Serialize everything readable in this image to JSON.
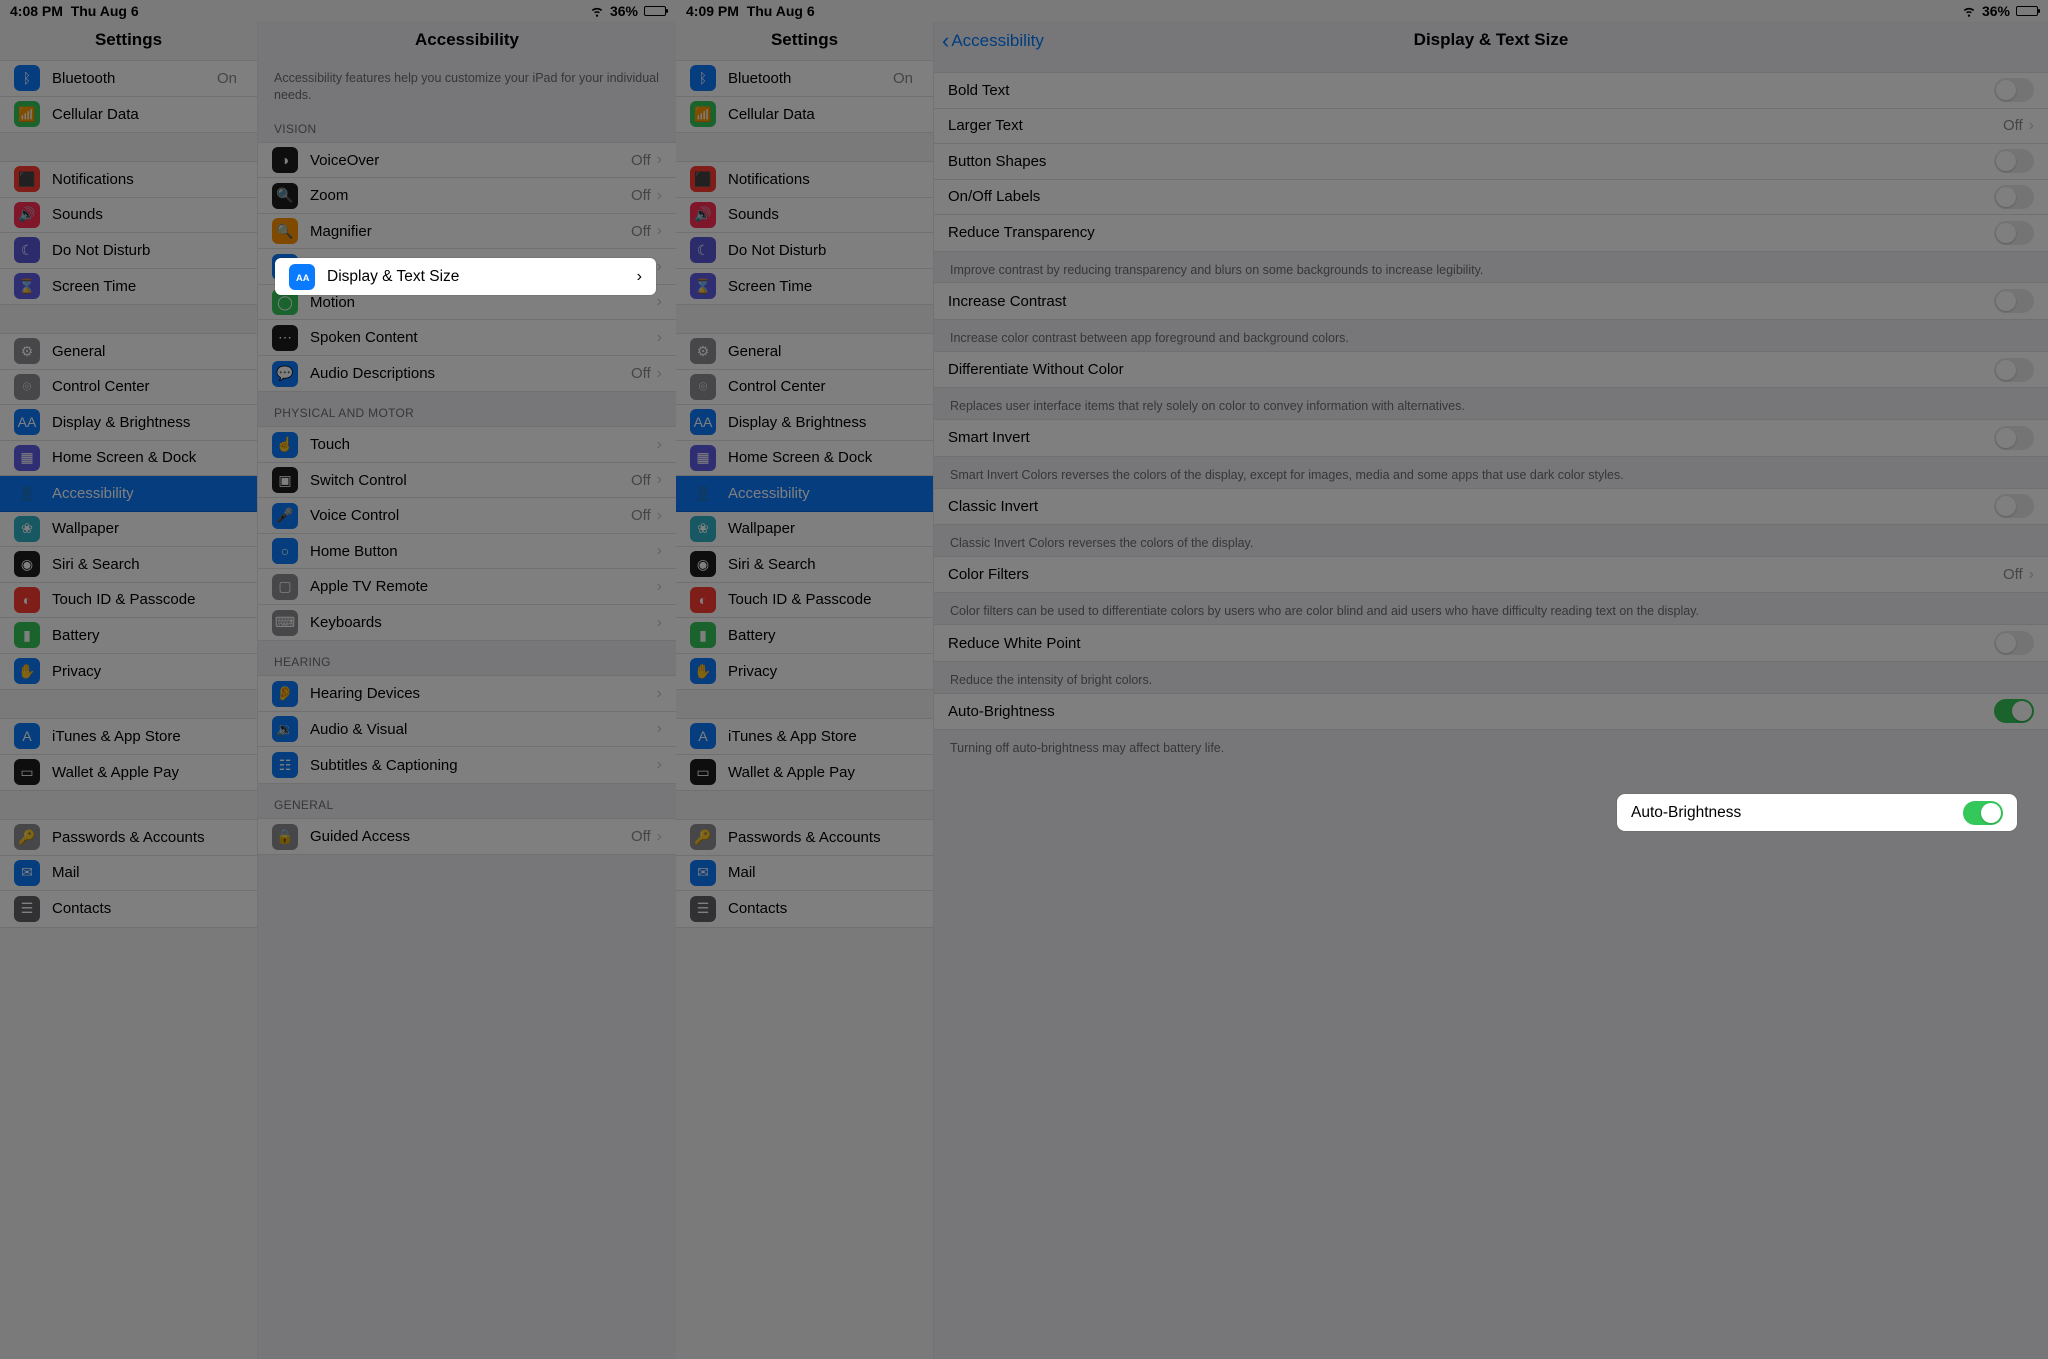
{
  "screenshots": {
    "left": {
      "status": {
        "time": "4:08 PM",
        "date": "Thu Aug 6",
        "battery": "36%"
      }
    },
    "right": {
      "status": {
        "time": "4:09 PM",
        "date": "Thu Aug 6",
        "battery": "36%"
      }
    }
  },
  "sidebar": {
    "title": "Settings",
    "groups": [
      {
        "items": [
          {
            "icon": "bluetooth-icon",
            "color": "bg-blue",
            "label": "Bluetooth",
            "value": "On"
          },
          {
            "icon": "cellular-icon",
            "color": "bg-green",
            "label": "Cellular Data"
          }
        ]
      },
      {
        "items": [
          {
            "icon": "notifications-icon",
            "color": "bg-red",
            "label": "Notifications"
          },
          {
            "icon": "sounds-icon",
            "color": "bg-pink",
            "label": "Sounds"
          },
          {
            "icon": "dnd-icon",
            "color": "bg-purple",
            "label": "Do Not Disturb"
          },
          {
            "icon": "screentime-icon",
            "color": "bg-indigo",
            "label": "Screen Time"
          }
        ]
      },
      {
        "items": [
          {
            "icon": "general-icon",
            "color": "bg-grey",
            "label": "General"
          },
          {
            "icon": "controlcenter-icon",
            "color": "bg-grey",
            "label": "Control Center"
          },
          {
            "icon": "display-icon",
            "color": "bg-blue",
            "label": "Display & Brightness"
          },
          {
            "icon": "homescreen-icon",
            "color": "bg-indigo",
            "label": "Home Screen & Dock"
          },
          {
            "icon": "accessibility-icon",
            "color": "bg-blue",
            "label": "Accessibility",
            "selected": true
          },
          {
            "icon": "wallpaper-icon",
            "color": "bg-teal",
            "label": "Wallpaper"
          },
          {
            "icon": "siri-icon",
            "color": "bg-black",
            "label": "Siri & Search"
          },
          {
            "icon": "touchid-icon",
            "color": "bg-red",
            "label": "Touch ID & Passcode"
          },
          {
            "icon": "battery-icon",
            "color": "bg-green",
            "label": "Battery"
          },
          {
            "icon": "privacy-icon",
            "color": "bg-blue",
            "label": "Privacy"
          }
        ]
      },
      {
        "items": [
          {
            "icon": "appstore-icon",
            "color": "bg-blue",
            "label": "iTunes & App Store"
          },
          {
            "icon": "wallet-icon",
            "color": "bg-black",
            "label": "Wallet & Apple Pay"
          }
        ]
      },
      {
        "items": [
          {
            "icon": "passwords-icon",
            "color": "bg-grey",
            "label": "Passwords & Accounts"
          },
          {
            "icon": "mail-icon",
            "color": "bg-blue",
            "label": "Mail"
          },
          {
            "icon": "contacts-icon",
            "color": "bg-darkgrey",
            "label": "Contacts"
          }
        ]
      }
    ]
  },
  "accessibility_detail": {
    "title": "Accessibility",
    "help": "Accessibility features help you customize your iPad for your individual needs.",
    "sections": [
      {
        "header": "VISION",
        "items": [
          {
            "icon": "voiceover-icon",
            "color": "bg-black",
            "label": "VoiceOver",
            "value": "Off",
            "chev": true
          },
          {
            "icon": "zoom-icon",
            "color": "bg-black",
            "label": "Zoom",
            "value": "Off",
            "chev": true
          },
          {
            "icon": "magnifier-icon",
            "color": "bg-orange",
            "label": "Magnifier",
            "value": "Off",
            "chev": true
          },
          {
            "icon": "displaytext-icon",
            "color": "bg-blue",
            "label": "Display & Text Size",
            "chev": true,
            "highlight": true
          },
          {
            "icon": "motion-icon",
            "color": "bg-green",
            "label": "Motion",
            "chev": true
          },
          {
            "icon": "spoken-icon",
            "color": "bg-black",
            "label": "Spoken Content",
            "chev": true
          },
          {
            "icon": "audiodesc-icon",
            "color": "bg-blue",
            "label": "Audio Descriptions",
            "value": "Off",
            "chev": true
          }
        ]
      },
      {
        "header": "PHYSICAL AND MOTOR",
        "items": [
          {
            "icon": "touch-icon",
            "color": "bg-blue",
            "label": "Touch",
            "chev": true
          },
          {
            "icon": "switchcontrol-icon",
            "color": "bg-black",
            "label": "Switch Control",
            "value": "Off",
            "chev": true
          },
          {
            "icon": "voicecontrol-icon",
            "color": "bg-blue",
            "label": "Voice Control",
            "value": "Off",
            "chev": true
          },
          {
            "icon": "homebutton-icon",
            "color": "bg-blue",
            "label": "Home Button",
            "chev": true
          },
          {
            "icon": "appletv-icon",
            "color": "bg-grey",
            "label": "Apple TV Remote",
            "chev": true
          },
          {
            "icon": "keyboards-icon",
            "color": "bg-grey",
            "label": "Keyboards",
            "chev": true
          }
        ]
      },
      {
        "header": "HEARING",
        "items": [
          {
            "icon": "hearing-icon",
            "color": "bg-blue",
            "label": "Hearing Devices",
            "chev": true
          },
          {
            "icon": "audiovisual-icon",
            "color": "bg-blue",
            "label": "Audio & Visual",
            "chev": true
          },
          {
            "icon": "subtitles-icon",
            "color": "bg-blue",
            "label": "Subtitles & Captioning",
            "chev": true
          }
        ]
      },
      {
        "header": "GENERAL",
        "items": [
          {
            "icon": "guided-icon",
            "color": "bg-grey",
            "label": "Guided Access",
            "value": "Off",
            "chev": true
          }
        ]
      }
    ]
  },
  "display_text_detail": {
    "back": "Accessibility",
    "title": "Display & Text Size",
    "sections": [
      {
        "items": [
          {
            "label": "Bold Text",
            "toggle": false
          },
          {
            "label": "Larger Text",
            "value": "Off",
            "chev": true
          },
          {
            "label": "Button Shapes",
            "toggle": false
          },
          {
            "label": "On/Off Labels",
            "toggle": false
          },
          {
            "label": "Reduce Transparency",
            "toggle": false
          }
        ],
        "footer": "Improve contrast by reducing transparency and blurs on some backgrounds to increase legibility."
      },
      {
        "items": [
          {
            "label": "Increase Contrast",
            "toggle": false
          }
        ],
        "footer": "Increase color contrast between app foreground and background colors."
      },
      {
        "items": [
          {
            "label": "Differentiate Without Color",
            "toggle": false
          }
        ],
        "footer": "Replaces user interface items that rely solely on color to convey information with alternatives."
      },
      {
        "items": [
          {
            "label": "Smart Invert",
            "toggle": false
          }
        ],
        "footer": "Smart Invert Colors reverses the colors of the display, except for images, media and some apps that use dark color styles."
      },
      {
        "items": [
          {
            "label": "Classic Invert",
            "toggle": false
          }
        ],
        "footer": "Classic Invert Colors reverses the colors of the display."
      },
      {
        "items": [
          {
            "label": "Color Filters",
            "value": "Off",
            "chev": true
          }
        ],
        "footer": "Color filters can be used to differentiate colors by users who are color blind and aid users who have difficulty reading text on the display."
      },
      {
        "items": [
          {
            "label": "Reduce White Point",
            "toggle": false
          }
        ],
        "footer": "Reduce the intensity of bright colors."
      },
      {
        "items": [
          {
            "label": "Auto-Brightness",
            "toggle": true,
            "highlight": true
          }
        ],
        "footer": "Turning off auto-brightness may affect battery life."
      }
    ]
  }
}
